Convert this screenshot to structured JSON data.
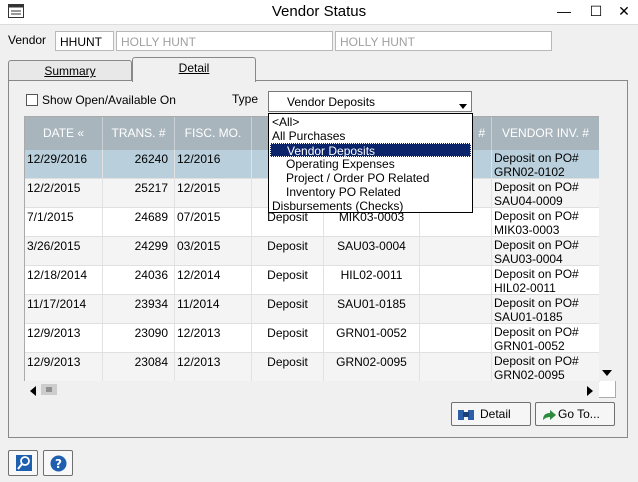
{
  "window": {
    "title": "Vendor Status",
    "minimize_glyph": "—",
    "maximize_glyph": "☐",
    "close_glyph": "✕"
  },
  "vendor": {
    "label": "Vendor",
    "code": "HHUNT",
    "name": "HOLLY HUNT",
    "name2": "HOLLY HUNT"
  },
  "tabs": [
    {
      "label": "Summary"
    },
    {
      "label": "Detail"
    }
  ],
  "filters": {
    "show_open_label": "Show Open/Available On",
    "show_open_checked": false,
    "type_label": "Type",
    "type_value": "Vendor Deposits"
  },
  "type_options": [
    "<All>",
    "All Purchases",
    "Vendor Deposits",
    "Operating Expenses",
    "Project / Order PO Related",
    "Inventory PO Related",
    "Disbursements (Checks)"
  ],
  "grid": {
    "headers": [
      "DATE «",
      "TRANS. #",
      "FISC. MO.",
      "",
      "",
      "#",
      "VENDOR INV. #"
    ],
    "rows": [
      {
        "date": "12/29/2016",
        "trans": "26240",
        "fisc": "12/2016",
        "type": "",
        "ref": "",
        "inv1": "Deposit on PO#",
        "inv2": "GRN02-0102"
      },
      {
        "date": "12/2/2015",
        "trans": "25217",
        "fisc": "12/2015",
        "type": "",
        "ref": "",
        "inv1": "Deposit on PO#",
        "inv2": "SAU04-0009"
      },
      {
        "date": "7/1/2015",
        "trans": "24689",
        "fisc": "07/2015",
        "type": "Deposit",
        "ref": "MIK03-0003",
        "inv1": "Deposit on PO#",
        "inv2": "MIK03-0003"
      },
      {
        "date": "3/26/2015",
        "trans": "24299",
        "fisc": "03/2015",
        "type": "Deposit",
        "ref": "SAU03-0004",
        "inv1": "Deposit on PO#",
        "inv2": "SAU03-0004"
      },
      {
        "date": "12/18/2014",
        "trans": "24036",
        "fisc": "12/2014",
        "type": "Deposit",
        "ref": "HIL02-0011",
        "inv1": "Deposit on PO#",
        "inv2": "HIL02-0011"
      },
      {
        "date": "11/17/2014",
        "trans": "23934",
        "fisc": "11/2014",
        "type": "Deposit",
        "ref": "SAU01-0185",
        "inv1": "Deposit on PO#",
        "inv2": "SAU01-0185"
      },
      {
        "date": "12/9/2013",
        "trans": "23090",
        "fisc": "12/2013",
        "type": "Deposit",
        "ref": "GRN01-0052",
        "inv1": "Deposit on PO#",
        "inv2": "GRN01-0052"
      },
      {
        "date": "12/9/2013",
        "trans": "23084",
        "fisc": "12/2013",
        "type": "Deposit",
        "ref": "GRN02-0095",
        "inv1": "Deposit on PO#",
        "inv2": "GRN02-0095"
      }
    ]
  },
  "buttons": {
    "detail": "Detail",
    "goto": "Go To..."
  },
  "icons": {
    "app": "app-window-icon",
    "search": "search-icon",
    "help": "help-icon"
  },
  "colors": {
    "header_bg": "#a8b5bd",
    "selected_row": "#b9cfdb",
    "highlight": "#0c246a"
  }
}
